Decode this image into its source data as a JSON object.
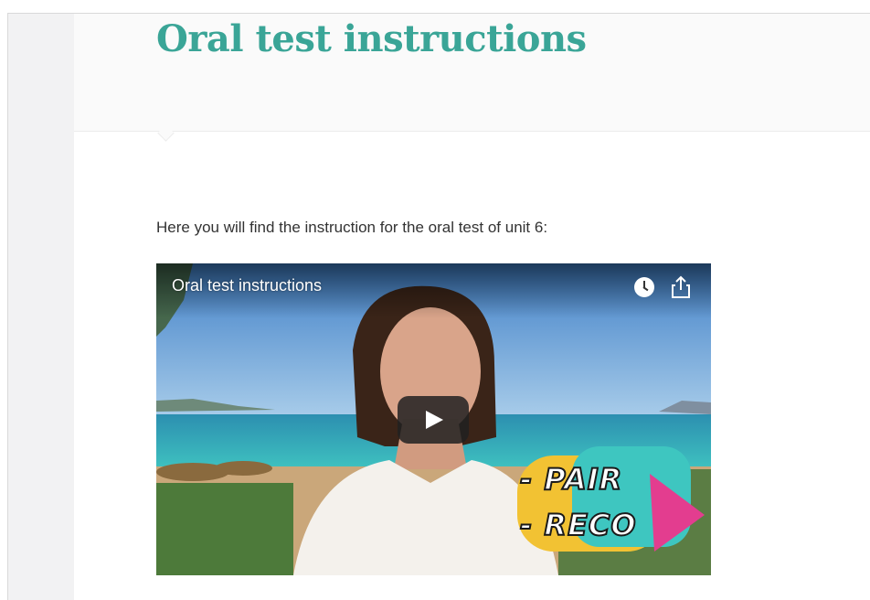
{
  "page": {
    "title": "Oral test instructions",
    "intro_text": "Here you will find the instruction for the oral test of unit 6:"
  },
  "video": {
    "title": "Oral test instructions",
    "overlay_line1": "- PAIR",
    "overlay_line2": "- RECO",
    "icons": [
      "clock-icon",
      "share-icon",
      "play-icon"
    ]
  },
  "colors": {
    "title": "#3aa597",
    "text": "#333333",
    "gutter": "#f2f2f3"
  }
}
